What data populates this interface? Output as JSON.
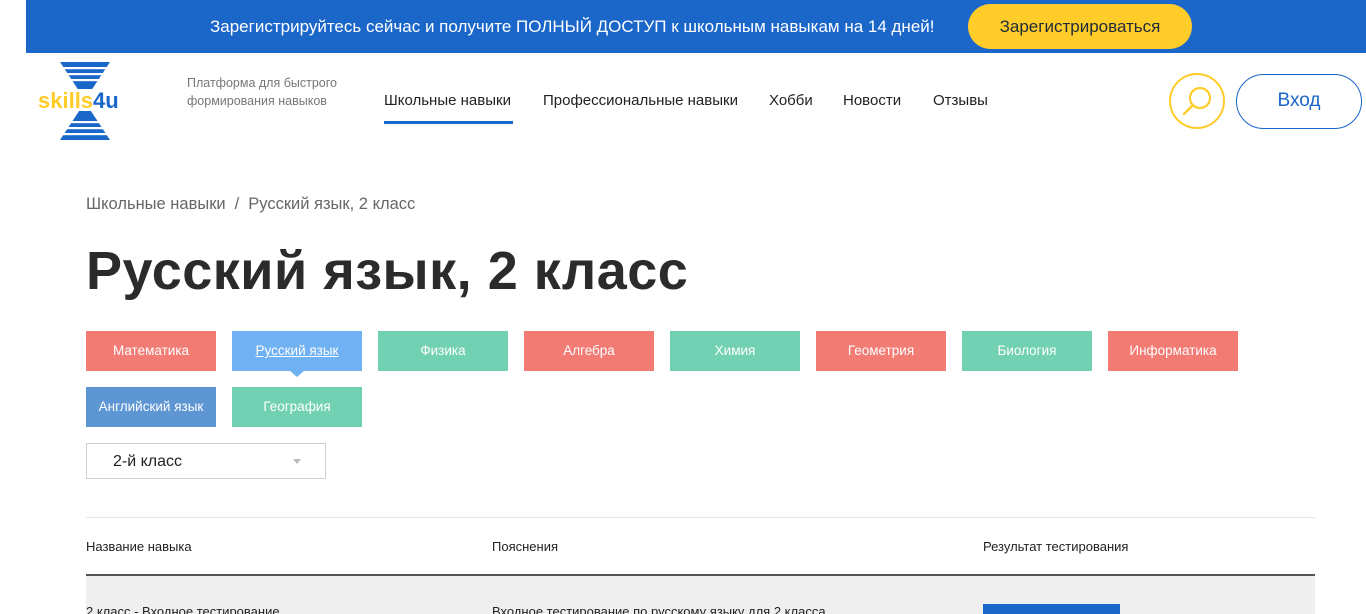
{
  "promo": {
    "text": "Зарегистрируйтесь сейчас и получите ПОЛНЫЙ ДОСТУП к школьным навыкам на 14 дней!",
    "button": "Зарегистрироваться"
  },
  "logo": {
    "text": "skills4u"
  },
  "tagline": "Платформа для быстрого формирования навыков",
  "nav": {
    "items": [
      "Школьные навыки",
      "Профессиональные навыки",
      "Хобби",
      "Новости",
      "Отзывы"
    ],
    "active_index": 0
  },
  "header": {
    "login": "Вход"
  },
  "breadcrumb": {
    "root": "Школьные навыки",
    "separator": "/",
    "current": "Русский язык, 2 класс"
  },
  "page_title": "Русский язык, 2 класс",
  "subjects": {
    "items": [
      {
        "label": "Математика",
        "color": "#f27b74"
      },
      {
        "label": "Русский язык",
        "color": "#6fb1f2",
        "active": true
      },
      {
        "label": "Физика",
        "color": "#72d1b2"
      },
      {
        "label": "Алгебра",
        "color": "#f27b74"
      },
      {
        "label": "Химия",
        "color": "#72d1b2"
      },
      {
        "label": "Геометрия",
        "color": "#f27b74"
      },
      {
        "label": "Биология",
        "color": "#72d1b2"
      },
      {
        "label": "Информатика",
        "color": "#f27b74"
      },
      {
        "label": "Английский язык",
        "color": "#5d96d2"
      },
      {
        "label": "География",
        "color": "#72d1b2"
      }
    ]
  },
  "grade_select": {
    "value": "2-й класс"
  },
  "table": {
    "headers": [
      "Название навыка",
      "Пояснения",
      "Результат тестирования"
    ],
    "rows": [
      [
        "2 класс - Входное тестирование",
        "Входное тестирование по русскому языку для 2 класса",
        ""
      ]
    ]
  },
  "colors": {
    "brand_blue": "#1a66c9",
    "accent_yellow": "#ffcc29"
  }
}
